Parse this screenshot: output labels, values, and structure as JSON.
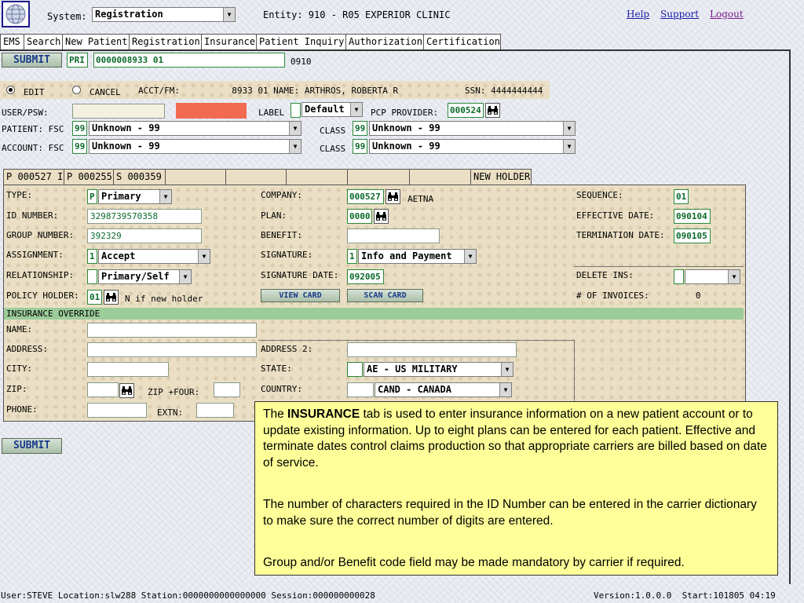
{
  "header": {
    "system_label": "System:",
    "system_value": "Registration",
    "entity_text": "Entity: 910 - R05 EXPERIOR CLINIC",
    "links": {
      "help": "Help",
      "support": "Support",
      "logout": "Logout"
    }
  },
  "tabs": [
    "EMS",
    "Search",
    "New Patient",
    "Registration",
    "Insurance",
    "Patient Inquiry",
    "Authorization",
    "Certification"
  ],
  "top": {
    "submit_label": "SUBMIT",
    "pri_label": "PRI",
    "account_value": "0000008933 01",
    "account_suffix": "0910"
  },
  "acct_bar": {
    "edit_label": "EDIT",
    "cancel_label": "CANCEL",
    "acct_fm": "ACCT/FM:          8933 01 NAME: ARTHROS, ROBERTA R",
    "ssn": "SSN: 4444444444"
  },
  "rows": {
    "user_psw_label": "USER/PSW:",
    "label_label": "LABEL",
    "label_select": "Default",
    "pcp_label": "PCP PROVIDER:",
    "pcp_value": "000524",
    "patient_fsc_label": "PATIENT: FSC",
    "patient_fsc_code": "99",
    "patient_fsc_value": "Unknown - 99",
    "patient_class_label": "CLASS",
    "patient_class_code": "99",
    "patient_class_value": "Unknown - 99",
    "account_fsc_label": "ACCOUNT: FSC",
    "account_fsc_code": "99",
    "account_fsc_value": "Unknown - 99",
    "account_class_label": "CLASS",
    "account_class_code": "99",
    "account_class_value": "Unknown - 99"
  },
  "ins_tabs": [
    "P 000527 I",
    "P 000255",
    "S 000359",
    "",
    "",
    "",
    "",
    "",
    "NEW HOLDER"
  ],
  "insurance": {
    "type_label": "TYPE:",
    "type_code": "P",
    "type_value": "Primary",
    "company_label": "COMPANY:",
    "company_code": "000527",
    "company_name": "AETNA",
    "sequence_label": "SEQUENCE:",
    "sequence_value": "01",
    "id_label": "ID NUMBER:",
    "id_value": "3298739570358",
    "plan_label": "PLAN:",
    "plan_value": "0000",
    "effective_label": "EFFECTIVE DATE:",
    "effective_value": "090104",
    "group_label": "GROUP NUMBER:",
    "group_value": "392329",
    "benefit_label": "BENEFIT:",
    "benefit_value": "",
    "termination_label": "TERMINATION DATE:",
    "termination_value": "090105",
    "assignment_label": "ASSIGNMENT:",
    "assignment_code": "1",
    "assignment_value": "Accept",
    "signature_label": "SIGNATURE:",
    "signature_code": "1",
    "signature_value": "Info and Payment",
    "relationship_label": "RELATIONSHIP:",
    "relationship_value": "Primary/Self",
    "sigdate_label": "SIGNATURE DATE:",
    "sigdate_value": "092005",
    "delete_label": "DELETE INS:",
    "holder_label": "POLICY HOLDER:",
    "holder_code": "01",
    "holder_note": "N if new holder",
    "view_card": "VIEW CARD",
    "scan_card": "SCAN CARD",
    "invoices_label": "# OF INVOICES:",
    "invoices_value": "0"
  },
  "override": {
    "title": "INSURANCE OVERRIDE",
    "name_label": "NAME:",
    "address_label": "ADDRESS:",
    "address2_label": "ADDRESS 2:",
    "city_label": "CITY:",
    "state_label": "STATE:",
    "state_value": "AE - US MILITARY",
    "zip_label": "ZIP:",
    "zip4_label": "ZIP +FOUR:",
    "country_label": "COUNTRY:",
    "country_value": "CAND - CANADA",
    "phone_label": "PHONE:",
    "extn_label": "EXTN:"
  },
  "bottom_submit": "SUBMIT",
  "note": {
    "p1_before": "The ",
    "p1_bold": "INSURANCE",
    "p1_after": " tab is used to enter insurance information on a new patient account or to update existing information. Up to eight plans can be entered for each patient.  Effective and terminate dates control claims production so that appropriate carriers are billed based on date of service.",
    "p2": "The number of characters required in the ID Number can be entered in the carrier dictionary to make sure the correct number of digits are entered.",
    "p3": "Group and/or Benefit code field may be made mandatory by carrier if required."
  },
  "status": {
    "left": "User:STEVE Location:slw288 Station:0000000000000000 Session:000000000028",
    "right": "Version:1.0.0.0  Start:101805 04:19"
  },
  "colors": {
    "field_text": "#0a6a2a",
    "override_bar": "#9ccc9a",
    "note_bg": "#ffff99",
    "password_fill": "#f26a4f"
  }
}
